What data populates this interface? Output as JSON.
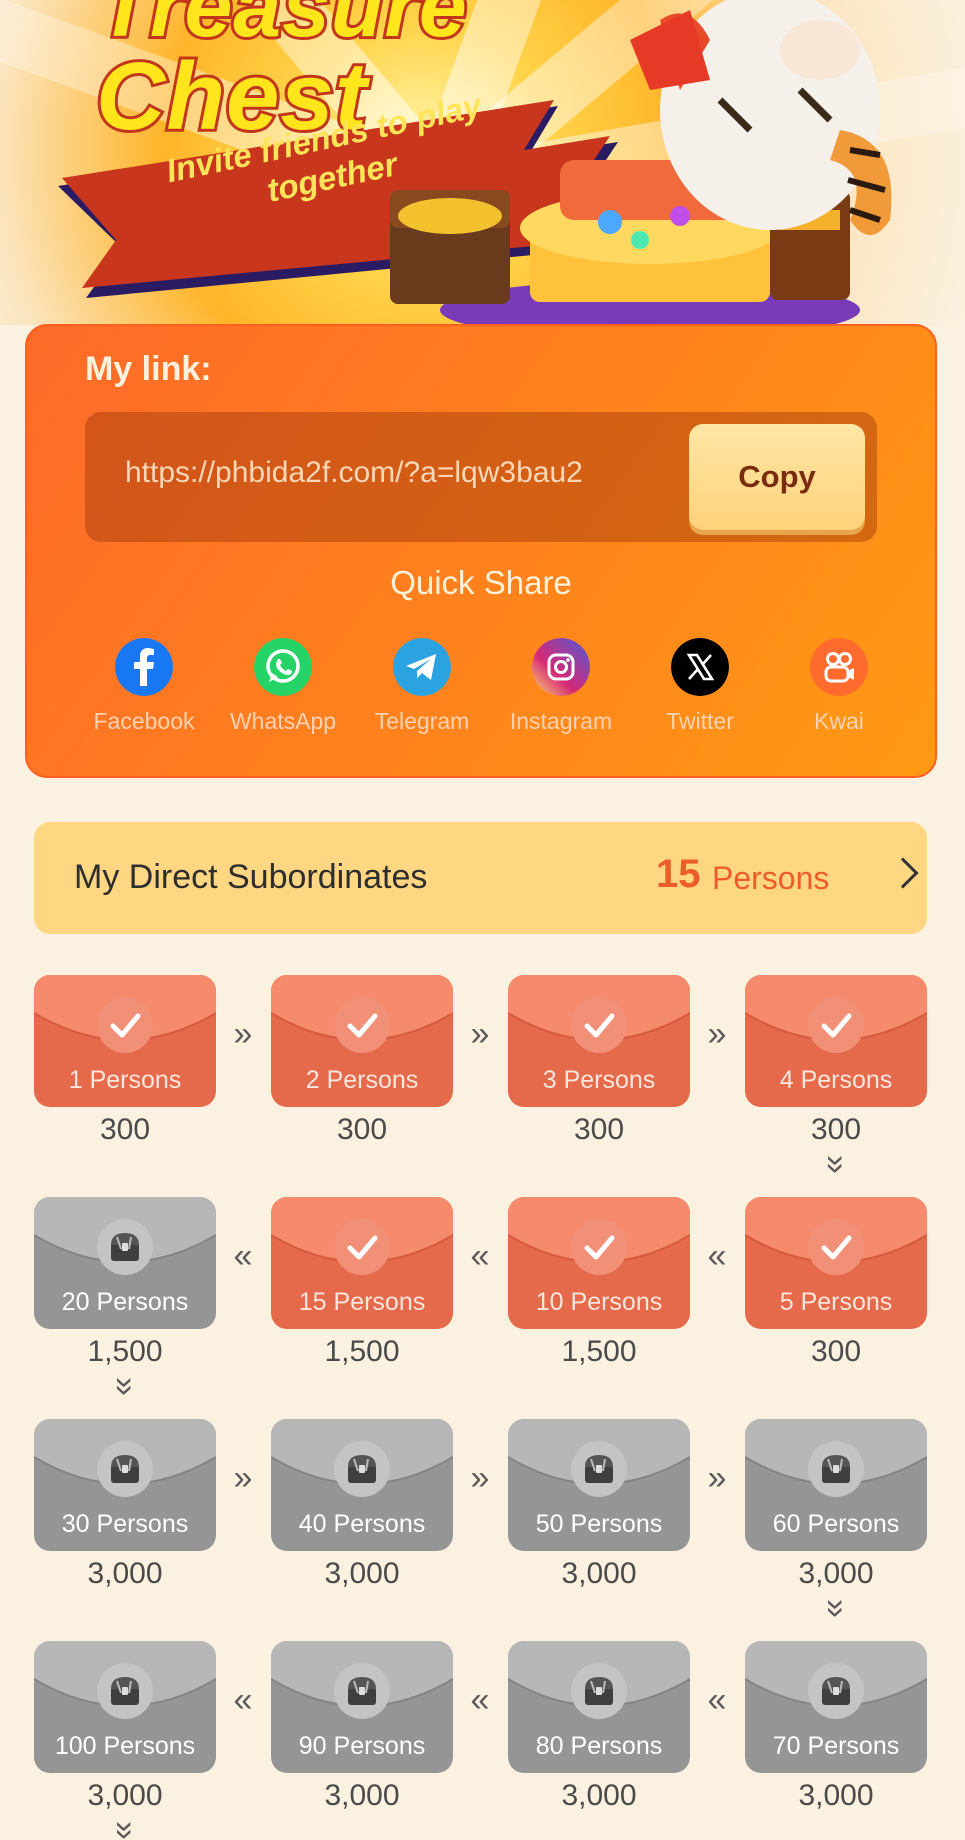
{
  "banner": {
    "title_line1": "Treasure",
    "title_line2": "Chest",
    "ribbon_line1": "Invite friends to play",
    "ribbon_line2": "together"
  },
  "link_card": {
    "label": "My link:",
    "url": "https://phbida2f.com/?a=lqw3bau2",
    "copy_label": "Copy",
    "quick_share_label": "Quick Share",
    "share": [
      {
        "label": "Facebook",
        "icon": "facebook-icon",
        "color": "#1877f2"
      },
      {
        "label": "WhatsApp",
        "icon": "whatsapp-icon",
        "color": "#25d366"
      },
      {
        "label": "Telegram",
        "icon": "telegram-icon",
        "color": "#2aa3e0"
      },
      {
        "label": "Instagram",
        "icon": "instagram-icon",
        "color": "#c13584"
      },
      {
        "label": "Twitter",
        "icon": "twitter-x-icon",
        "color": "#000000"
      },
      {
        "label": "Kwai",
        "icon": "kwai-icon",
        "color": "#ff6b2c"
      }
    ]
  },
  "subordinates": {
    "label": "My Direct Subordinates",
    "count": "15",
    "unit": "Persons"
  },
  "milestones": [
    {
      "label": "1 Persons",
      "value": "300",
      "status": "done"
    },
    {
      "label": "2 Persons",
      "value": "300",
      "status": "done"
    },
    {
      "label": "3 Persons",
      "value": "300",
      "status": "done"
    },
    {
      "label": "4 Persons",
      "value": "300",
      "status": "done"
    },
    {
      "label": "5 Persons",
      "value": "300",
      "status": "done"
    },
    {
      "label": "10 Persons",
      "value": "1,500",
      "status": "done"
    },
    {
      "label": "15 Persons",
      "value": "1,500",
      "status": "done"
    },
    {
      "label": "20 Persons",
      "value": "1,500",
      "status": "locked"
    },
    {
      "label": "30 Persons",
      "value": "3,000",
      "status": "locked"
    },
    {
      "label": "40 Persons",
      "value": "3,000",
      "status": "locked"
    },
    {
      "label": "50 Persons",
      "value": "3,000",
      "status": "locked"
    },
    {
      "label": "60 Persons",
      "value": "3,000",
      "status": "locked"
    },
    {
      "label": "70 Persons",
      "value": "3,000",
      "status": "locked"
    },
    {
      "label": "80 Persons",
      "value": "3,000",
      "status": "locked"
    },
    {
      "label": "90 Persons",
      "value": "3,000",
      "status": "locked"
    },
    {
      "label": "100 Persons",
      "value": "3,000",
      "status": "locked"
    }
  ],
  "colors": {
    "card_orange": "#ff7e1e",
    "done_envelope": "#e56a4c",
    "locked_envelope": "#959595",
    "accent_count": "#ec5d2a",
    "subordinate_bar": "#ffd681"
  }
}
